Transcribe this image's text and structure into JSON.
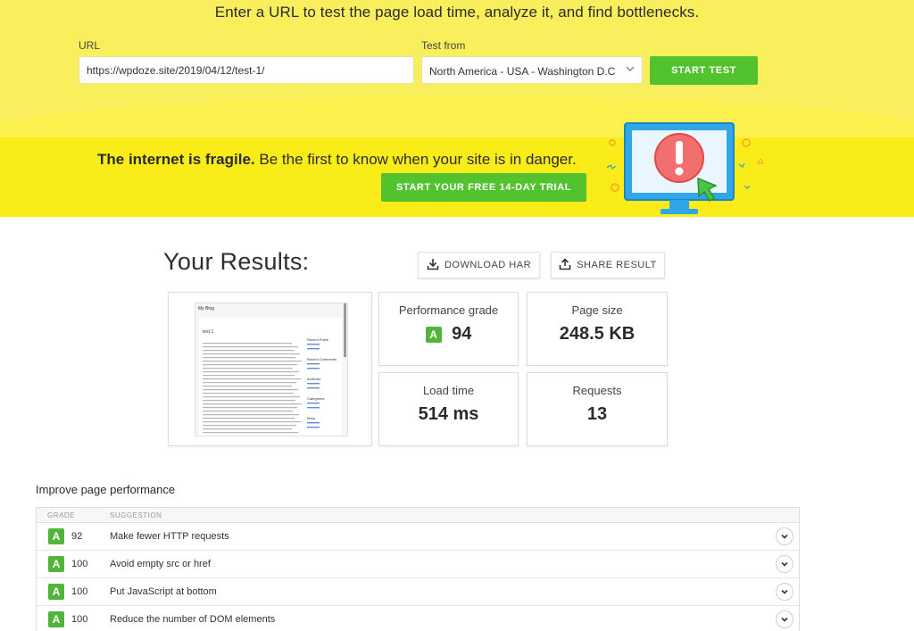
{
  "form": {
    "headline": "Enter a URL to test the page load time, analyze it, and find bottlenecks.",
    "url_label": "URL",
    "url_value": "https://wpdoze.site/2019/04/12/test-1/",
    "test_from_label": "Test from",
    "test_from_value": "North America - USA - Washington D.C",
    "start_button": "START TEST"
  },
  "promo": {
    "bold_text": "The internet is fragile.",
    "text": " Be the first to know when your site is in danger.",
    "trial_button": "START YOUR FREE 14-DAY TRIAL"
  },
  "results": {
    "title": "Your Results:",
    "download_har": "DOWNLOAD HAR",
    "share_result": "SHARE RESULT",
    "screenshot": {
      "blog_title": "My Blog",
      "post_title": "test 1",
      "sidebar_headings": [
        "Recent Posts",
        "Recent Comments",
        "Archives",
        "Categories",
        "Meta"
      ]
    },
    "performance_grade": {
      "label": "Performance grade",
      "grade": "A",
      "value": "94"
    },
    "page_size": {
      "label": "Page size",
      "value": "248.5 KB"
    },
    "load_time": {
      "label": "Load time",
      "value": "514 ms"
    },
    "requests": {
      "label": "Requests",
      "value": "13"
    }
  },
  "improve": {
    "title": "Improve page performance",
    "columns": [
      "GRADE",
      "SUGGESTION"
    ],
    "rows": [
      {
        "grade": "A",
        "score": "92",
        "suggestion": "Make fewer HTTP requests"
      },
      {
        "grade": "A",
        "score": "100",
        "suggestion": "Avoid empty src or href"
      },
      {
        "grade": "A",
        "score": "100",
        "suggestion": "Put JavaScript at bottom"
      },
      {
        "grade": "A",
        "score": "100",
        "suggestion": "Reduce the number of DOM elements"
      }
    ]
  },
  "colors": {
    "top_bg": "#f9ef5c",
    "promo_bg": "#f9ec18",
    "accent_green": "#52c22f",
    "grade_green": "#52b43a"
  },
  "icons": {
    "select_arrow": "chevron-down-icon",
    "download": "download-icon",
    "share": "share-icon",
    "expand": "chevron-down-icon",
    "promo_illustration": "monitor-alert-icon"
  }
}
